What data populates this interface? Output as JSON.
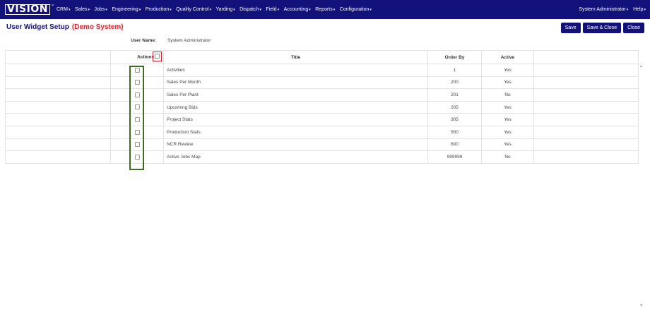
{
  "app": {
    "logo_text": "VISION",
    "logo_tm": "™"
  },
  "nav": {
    "items": [
      {
        "label": "CRM"
      },
      {
        "label": "Sales"
      },
      {
        "label": "Jobs"
      },
      {
        "label": "Engineering"
      },
      {
        "label": "Production"
      },
      {
        "label": "Quality Control"
      },
      {
        "label": "Yarding"
      },
      {
        "label": "Dispatch"
      },
      {
        "label": "Field"
      },
      {
        "label": "Accounting"
      },
      {
        "label": "Reports"
      },
      {
        "label": "Configuration"
      }
    ],
    "user": "System Administrator",
    "help": "Help",
    "caret": "▾"
  },
  "page": {
    "title": "User Widget Setup",
    "demo": "(Demo System)",
    "user_label": "User Name:",
    "user_value": "System Administrator"
  },
  "buttons": {
    "save": "Save",
    "save_close": "Save & Close",
    "close": "Close"
  },
  "table": {
    "headers": {
      "actions": "Actions",
      "title": "Title",
      "order_by": "Order By",
      "active": "Active"
    },
    "rows": [
      {
        "title": "Activities",
        "order": "1",
        "active": "Yes"
      },
      {
        "title": "Sales Per Month",
        "order": "200",
        "active": "Yes"
      },
      {
        "title": "Sales Per Plant",
        "order": "201",
        "active": "No"
      },
      {
        "title": "Upcoming Bids",
        "order": "205",
        "active": "Yes"
      },
      {
        "title": "Project Stats",
        "order": "305",
        "active": "Yes"
      },
      {
        "title": "Production Stats",
        "order": "500",
        "active": "Yes"
      },
      {
        "title": "NCR Review",
        "order": "600",
        "active": "Yes"
      },
      {
        "title": "Active Jobs Map",
        "order": "999999",
        "active": "No"
      }
    ]
  },
  "colors": {
    "navbar": "#12127a",
    "accent_red": "#e0202a",
    "highlight_green": "#3d6b1f"
  }
}
